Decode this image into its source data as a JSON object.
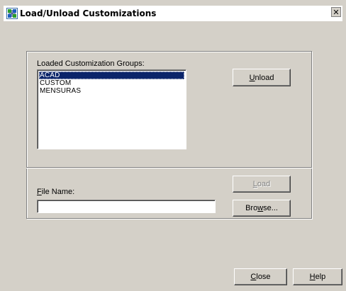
{
  "dialog": {
    "title": "Load/Unload Customizations",
    "close_glyph": "✕"
  },
  "groups": {
    "label_prefix": "Loaded Customization Groups:",
    "items": [
      {
        "label": "ACAD",
        "selected": true
      },
      {
        "label": "CUSTOM",
        "selected": false
      },
      {
        "label": "MENSURAS",
        "selected": false
      }
    ]
  },
  "buttons": {
    "unload": {
      "pre": "",
      "mn": "U",
      "post": "nload"
    },
    "load": {
      "pre": "",
      "mn": "L",
      "post": "oad",
      "enabled": false
    },
    "browse": {
      "pre": "Bro",
      "mn": "w",
      "post": "se..."
    },
    "close": {
      "pre": "",
      "mn": "C",
      "post": "lose"
    },
    "help": {
      "pre": "",
      "mn": "H",
      "post": "elp"
    }
  },
  "file": {
    "label_mn": "F",
    "label_rest": "ile Name:",
    "value": ""
  },
  "icons": {
    "app": "autocad-customize-icon",
    "close": "close-icon"
  },
  "colors": {
    "face": "#d4d0c8",
    "selection": "#0a246a",
    "disabled_text": "#808080"
  }
}
